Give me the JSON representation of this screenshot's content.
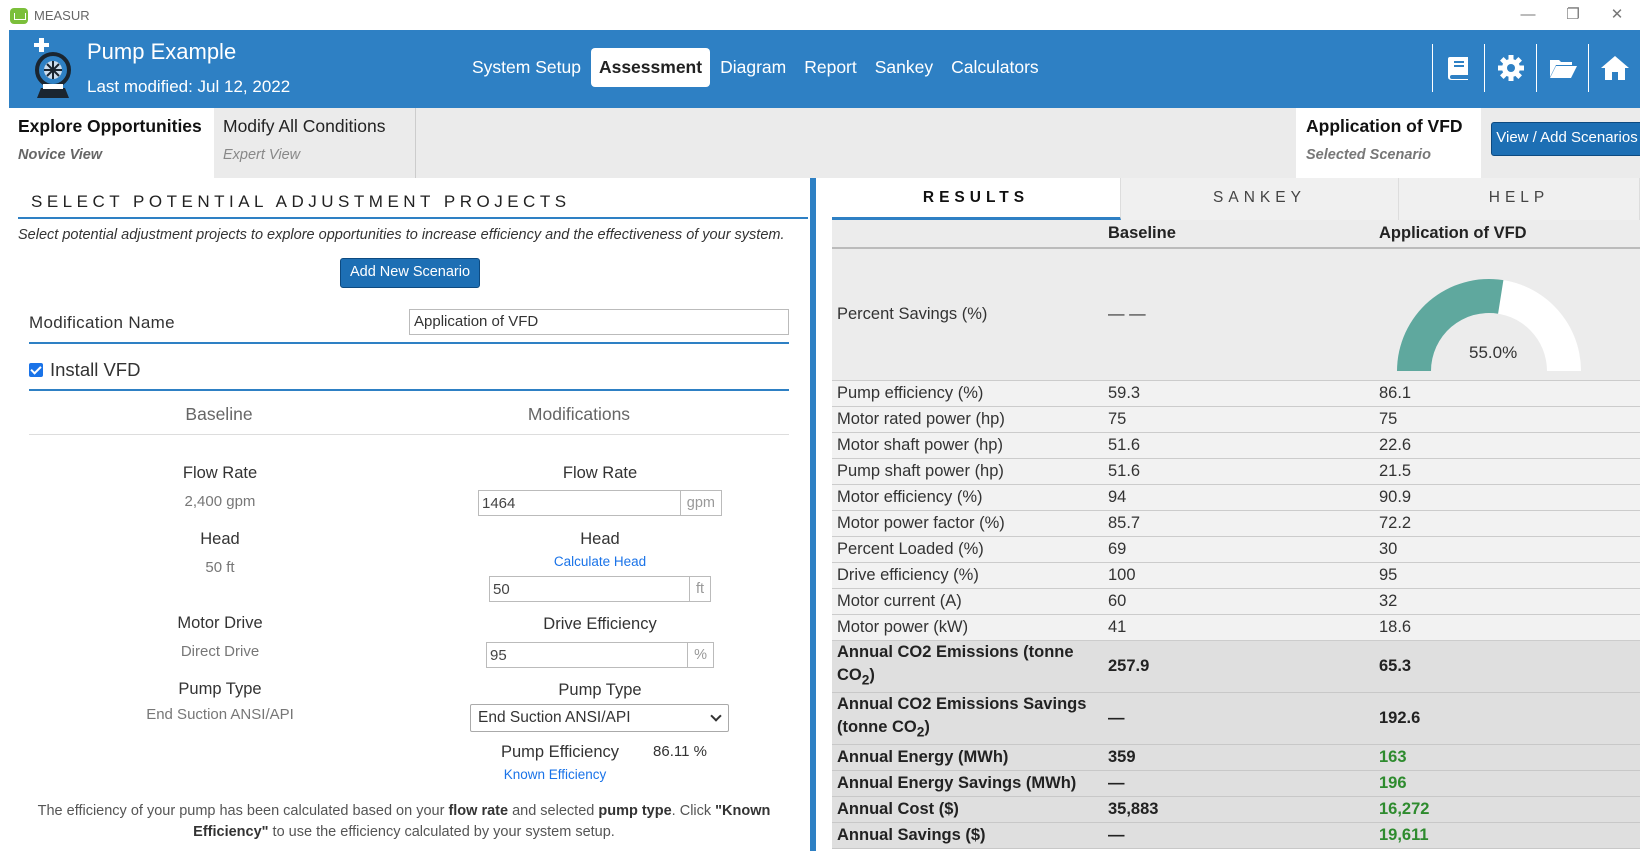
{
  "window": {
    "title": "MEASUR",
    "minimize": "—",
    "restore": "❐",
    "close": "✕"
  },
  "header": {
    "project_title": "Pump Example",
    "last_modified": "Last modified: Jul 12, 2022",
    "nav": [
      "System Setup",
      "Assessment",
      "Diagram",
      "Report",
      "Sankey",
      "Calculators"
    ],
    "active_nav": "Assessment",
    "icons": [
      "book-icon",
      "gear-icon",
      "folder-open-icon",
      "home-icon"
    ],
    "brand_color": "#2e80c4"
  },
  "subbar": {
    "explore": {
      "title": "Explore Opportunities",
      "subtitle": "Novice View"
    },
    "modify": {
      "title": "Modify All Conditions",
      "subtitle": "Expert View"
    },
    "selected": {
      "title": "Application of VFD",
      "subtitle": "Selected Scenario"
    },
    "view_add_button": "View / Add Scenarios"
  },
  "left": {
    "section_title": "SELECT POTENTIAL ADJUSTMENT PROJECTS",
    "description": "Select potential adjustment projects to explore opportunities to increase efficiency and the effectiveness of your system.",
    "add_button": "Add New Scenario",
    "modification_name_label": "Modification Name",
    "modification_name_value": "Application of VFD",
    "install_vfd_label": "Install VFD",
    "install_vfd_checked": true,
    "col_baseline": "Baseline",
    "col_modifications": "Modifications",
    "baseline": {
      "flow_rate_label": "Flow Rate",
      "flow_rate_value": "2,400 gpm",
      "head_label": "Head",
      "head_value": "50 ft",
      "motor_drive_label": "Motor Drive",
      "motor_drive_value": "Direct Drive",
      "pump_type_label": "Pump Type",
      "pump_type_value": "End Suction ANSI/API"
    },
    "modified": {
      "flow_rate_label": "Flow Rate",
      "flow_rate_value": "1464",
      "flow_rate_unit": "gpm",
      "head_label": "Head",
      "calc_head_link": "Calculate Head",
      "head_value": "50",
      "head_unit": "ft",
      "drive_eff_label": "Drive Efficiency",
      "drive_eff_value": "95",
      "drive_eff_unit": "%",
      "pump_type_label": "Pump Type",
      "pump_type_value": "End Suction ANSI/API",
      "pump_eff_label": "Pump Efficiency",
      "pump_eff_value": "86.11 %",
      "known_eff_link": "Known Efficiency"
    },
    "note": {
      "p1": "The efficiency of your pump has been calculated based on your ",
      "b1": "flow rate",
      "p2": " and selected ",
      "b2": "pump type",
      "p3": ". Click ",
      "b3": "\"Known Efficiency\"",
      "p4": " to use the efficiency calculated by your system setup."
    }
  },
  "right": {
    "tabs": [
      "RESULTS",
      "SANKEY",
      "HELP"
    ],
    "active_tab": "RESULTS",
    "col_baseline": "Baseline",
    "col_modified": "Application of VFD",
    "percent_savings": {
      "label": "Percent Savings (%)",
      "baseline": "— —",
      "modified": "55.0%",
      "fraction": 0.55
    },
    "rows": [
      {
        "label": "Pump efficiency (%)",
        "baseline": "59.3",
        "modified": "86.1"
      },
      {
        "label": "Motor rated power (hp)",
        "baseline": "75",
        "modified": "75"
      },
      {
        "label": "Motor shaft power (hp)",
        "baseline": "51.6",
        "modified": "22.6"
      },
      {
        "label": "Pump shaft power (hp)",
        "baseline": "51.6",
        "modified": "21.5"
      },
      {
        "label": "Motor efficiency (%)",
        "baseline": "94",
        "modified": "90.9"
      },
      {
        "label": "Motor power factor (%)",
        "baseline": "85.7",
        "modified": "72.2"
      },
      {
        "label": "Percent Loaded (%)",
        "baseline": "69",
        "modified": "30"
      },
      {
        "label": "Drive efficiency (%)",
        "baseline": "100",
        "modified": "95"
      },
      {
        "label": "Motor current (A)",
        "baseline": "60",
        "modified": "32"
      },
      {
        "label": "Motor power (kW)",
        "baseline": "41",
        "modified": "18.6"
      }
    ],
    "co2": {
      "label_a": "Annual CO2 Emissions (tonne CO",
      "label_sub": "2",
      "label_b": ")",
      "baseline": "257.9",
      "modified": "65.3"
    },
    "co2_savings": {
      "label_a": "Annual CO2 Emissions Savings (tonne CO",
      "label_sub": "2",
      "label_b": ")",
      "baseline": "—",
      "modified": "192.6"
    },
    "energy": {
      "label": "Annual Energy (MWh)",
      "baseline": "359",
      "modified": "163"
    },
    "energy_savings": {
      "label": "Annual Energy Savings (MWh)",
      "baseline": "—",
      "modified": "196"
    },
    "cost": {
      "label": "Annual Cost ($)",
      "baseline": "35,883",
      "modified": "16,272"
    },
    "savings": {
      "label": "Annual Savings ($)",
      "baseline": "—",
      "modified": "19,611"
    },
    "gauge_color": "#5fa89e",
    "green_color": "#2e8b2e"
  }
}
